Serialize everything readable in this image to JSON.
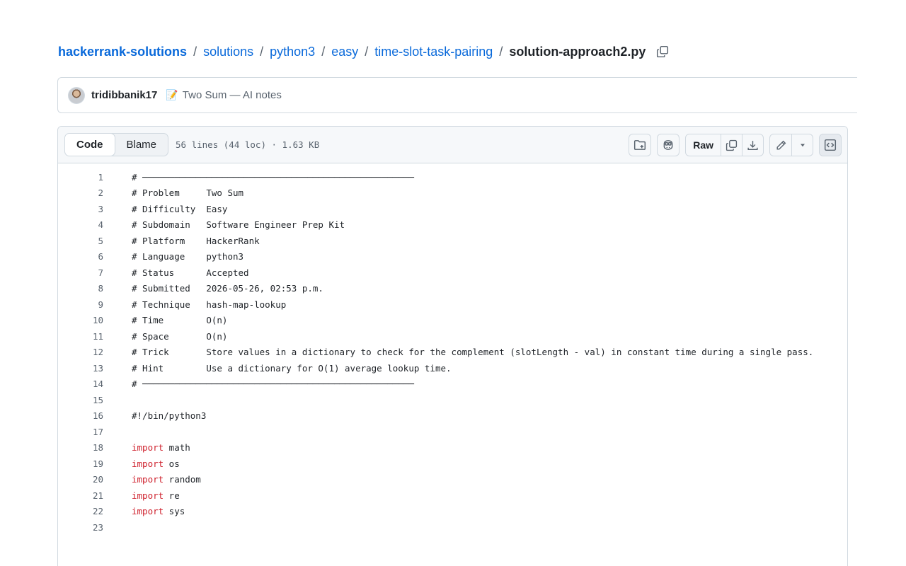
{
  "breadcrumb": {
    "repo": "hackerrank-solutions",
    "folders": [
      "solutions",
      "python3",
      "easy",
      "time-slot-task-pairing"
    ],
    "file": "solution-approach2.py",
    "separator": "/"
  },
  "commit": {
    "author": "tridibbanik17",
    "emoji": "📝",
    "message": "Two Sum — AI notes"
  },
  "file_header": {
    "tabs": [
      {
        "label": "Code",
        "active": true
      },
      {
        "label": "Blame",
        "active": false
      }
    ],
    "info": "56 lines (44 loc) · 1.63 KB",
    "raw_label": "Raw"
  },
  "colors": {
    "link": "#0969da",
    "keyword": "#cf222e",
    "muted": "#59636e",
    "border": "#d1d9e0"
  },
  "code_lines": [
    {
      "n": "1",
      "kw": "",
      "text": "# ───────────────────────────────────────────────────"
    },
    {
      "n": "2",
      "kw": "",
      "text": "# Problem     Two Sum"
    },
    {
      "n": "3",
      "kw": "",
      "text": "# Difficulty  Easy"
    },
    {
      "n": "4",
      "kw": "",
      "text": "# Subdomain   Software Engineer Prep Kit"
    },
    {
      "n": "5",
      "kw": "",
      "text": "# Platform    HackerRank"
    },
    {
      "n": "6",
      "kw": "",
      "text": "# Language    python3"
    },
    {
      "n": "7",
      "kw": "",
      "text": "# Status      Accepted"
    },
    {
      "n": "8",
      "kw": "",
      "text": "# Submitted   2026-05-26, 02:53 p.m."
    },
    {
      "n": "9",
      "kw": "",
      "text": "# Technique   hash-map-lookup"
    },
    {
      "n": "10",
      "kw": "",
      "text": "# Time        O(n)"
    },
    {
      "n": "11",
      "kw": "",
      "text": "# Space       O(n)"
    },
    {
      "n": "12",
      "kw": "",
      "text": "# Trick       Store values in a dictionary to check for the complement (slotLength - val) in constant time during a single pass."
    },
    {
      "n": "13",
      "kw": "",
      "text": "# Hint        Use a dictionary for O(1) average lookup time."
    },
    {
      "n": "14",
      "kw": "",
      "text": "# ───────────────────────────────────────────────────"
    },
    {
      "n": "15",
      "kw": "",
      "text": ""
    },
    {
      "n": "16",
      "kw": "",
      "text": "#!/bin/python3"
    },
    {
      "n": "17",
      "kw": "",
      "text": ""
    },
    {
      "n": "18",
      "kw": "import",
      "text": " math"
    },
    {
      "n": "19",
      "kw": "import",
      "text": " os"
    },
    {
      "n": "20",
      "kw": "import",
      "text": " random"
    },
    {
      "n": "21",
      "kw": "import",
      "text": " re"
    },
    {
      "n": "22",
      "kw": "import",
      "text": " sys"
    },
    {
      "n": "23",
      "kw": "",
      "text": ""
    }
  ]
}
